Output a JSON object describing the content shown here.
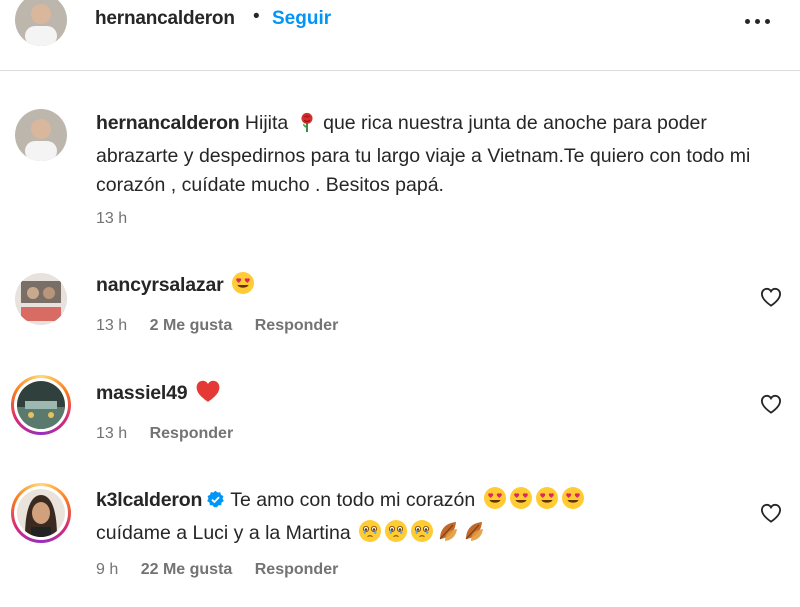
{
  "header": {
    "username": "hernancalderon",
    "separator": "•",
    "follow_label": "Seguir"
  },
  "caption": {
    "username": "hernancalderon",
    "text_part1": "Hijita",
    "text_part2": "que rica nuestra junta de anoche para poder abrazarte y despedirnos para tu largo viaje a Vietnam.Te quiero con todo mi corazón , cuídate mucho . Besitos papá.",
    "time": "13 h",
    "emoji_icon": "rose-emoji"
  },
  "comments": [
    {
      "username": "nancyrsalazar",
      "emojis": [
        "heart-eyes-emoji"
      ],
      "time": "13 h",
      "likes": "2 Me gusta",
      "reply_label": "Responder"
    },
    {
      "username": "massiel49",
      "emojis": [
        "red-heart-emoji"
      ],
      "time": "13 h",
      "reply_label": "Responder"
    },
    {
      "username": "k3lcalderon",
      "verified": true,
      "text_line1": "Te amo con todo mi corazón",
      "text_line2": "cuídame a Luci y a la Martina",
      "emojis_line1": [
        "heart-eyes-emoji",
        "heart-eyes-emoji",
        "heart-eyes-emoji",
        "heart-eyes-emoji"
      ],
      "emojis_line2": [
        "teary-emoji",
        "teary-emoji",
        "teary-emoji",
        "leaves-emoji",
        "leaves-emoji"
      ],
      "time": "9 h",
      "likes": "22 Me gusta",
      "reply_label": "Responder"
    }
  ],
  "colors": {
    "link_blue": "#0095f6",
    "text": "#262626",
    "meta_gray": "#737373",
    "verified_blue": "#0095f6"
  }
}
